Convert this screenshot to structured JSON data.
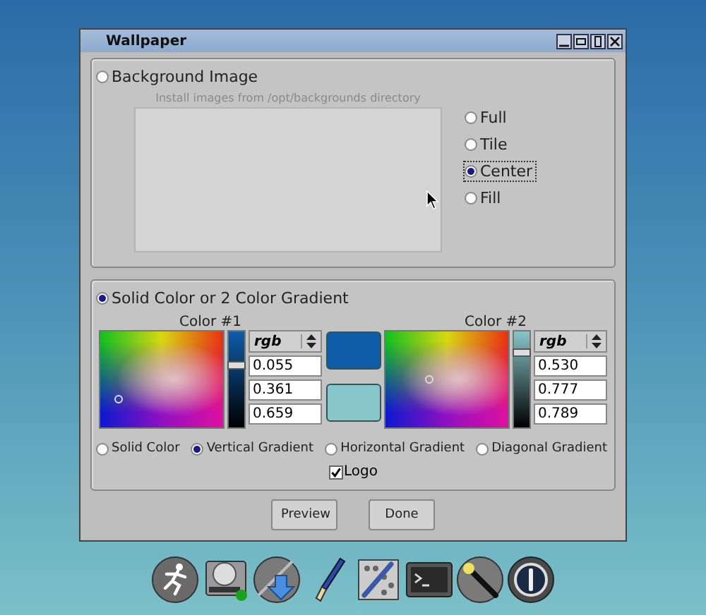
{
  "window": {
    "title": "Wallpaper"
  },
  "background_image": {
    "label": "Background Image",
    "selected": false,
    "hint": "Install images from /opt/backgrounds directory",
    "modes": [
      {
        "label": "Full",
        "selected": false
      },
      {
        "label": "Tile",
        "selected": false
      },
      {
        "label": "Center",
        "selected": true
      },
      {
        "label": "Fill",
        "selected": false
      }
    ]
  },
  "solid_color": {
    "label": "Solid Color or 2 Color Gradient",
    "selected": true,
    "colors": [
      {
        "title": "Color #1",
        "model": "rgb",
        "level": 0.659,
        "values": [
          "0.055",
          "0.361",
          "0.659"
        ],
        "color": "#0e5ca8"
      },
      {
        "title": "Color #2",
        "model": "rgb",
        "level": 0.789,
        "values": [
          "0.530",
          "0.777",
          "0.789"
        ],
        "color": "#87c6c9"
      }
    ],
    "gradients": [
      {
        "label": "Solid Color",
        "selected": false
      },
      {
        "label": "Vertical Gradient",
        "selected": true
      },
      {
        "label": "Horizontal Gradient",
        "selected": false
      },
      {
        "label": "Diagonal Gradient",
        "selected": false
      }
    ],
    "logo": {
      "label": "Logo",
      "checked": true
    }
  },
  "buttons": [
    "Preview",
    "Done"
  ]
}
